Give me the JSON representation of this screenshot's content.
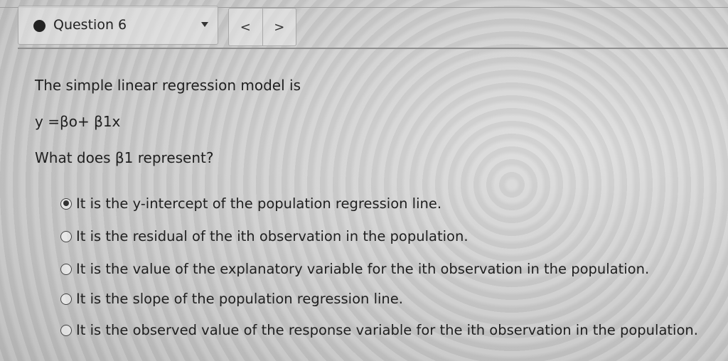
{
  "header": {
    "question_label": "Question 6",
    "prev_icon": "<",
    "next_icon": ">"
  },
  "question": {
    "intro": "The simple linear regression model is",
    "model": "y =βo+ β1x",
    "prompt": "What does β1 represent?"
  },
  "options": [
    {
      "label": "It is the y-intercept of the population regression line.",
      "selected": true
    },
    {
      "label": "It is the residual of the ith observation in the population.",
      "selected": false
    },
    {
      "label": "It is the value of the explanatory variable for the ith observation in the population.",
      "selected": false
    },
    {
      "label": "It is the slope of the population regression line.",
      "selected": false
    },
    {
      "label": "It is the observed value of the response variable for the ith observation in the population.",
      "selected": false
    }
  ]
}
